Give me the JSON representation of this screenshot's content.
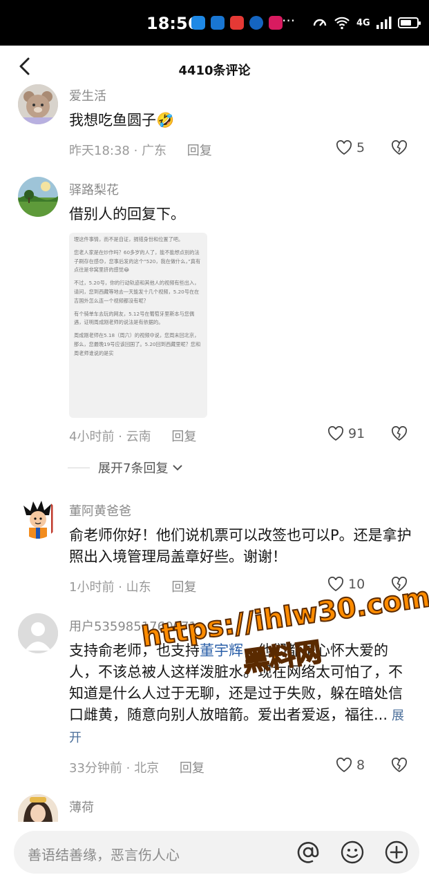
{
  "status_bar": {
    "time": "18:56",
    "network": "4G",
    "battery_level": 0.75
  },
  "header": {
    "title": "4410条评论"
  },
  "comments": [
    {
      "user": "爱生活",
      "text": "我想吃鱼圆子🤣",
      "time": "昨天18:38",
      "location": "广东",
      "reply": "回复",
      "likes": "5"
    },
    {
      "user": "驿路梨花",
      "text": "借别人的回复下。",
      "time": "4小时前",
      "location": "云南",
      "reply": "回复",
      "likes": "91",
      "expand": "展开7条回复"
    },
    {
      "user": "董阿黄爸爸",
      "text": "俞老师你好！他们说机票可以改签也可以P。还是拿护照出入境管理局盖章好些。谢谢！",
      "time": "1小时前",
      "location": "山东",
      "reply": "回复",
      "likes": "10"
    },
    {
      "user": "用户5359851760671",
      "text_prefix": "支持俞老师，也支持",
      "link": "董宇辉",
      "text_suffix": "，他们都是心怀大爱的人，不该总被人这样泼脏水。现在网络太可怕了，不知道是什么人过于无聊，还是过于失败，躲在暗处信口雌黄，随意向别人放暗箭。爱出者爱返，福往...",
      "more": "展开",
      "time": "33分钟前",
      "location": "北京",
      "reply": "回复",
      "likes": "8"
    },
    {
      "user": "薄荷"
    }
  ],
  "embedded_screenshot": [
    "理这件事情，而不是自证，捐错身份和位置了吧。",
    "您老人家是在炒作吗？60多岁的人了，能不能想点别的法子刷存在感😓，您事后发的这个“520，我在做什么，”真有点往是非窝里挤的感觉😂",
    "不过，5.20号，你的行动轨迹和其他人的视频有些出入，请问，您到西藏等地去一天能发十几个视频，5.20号在在吉国外怎么连一个视频都没有呢？",
    "有个骑单车去玩的网友，5.12号在葡萄牙里斯本与您偶遇，证明周成刚老师的说法是有依据的。",
    "周成刚老师在5.18（周六）的视频中说，您周末回北京，那么，您最晚19号应该回国了。5.20回到西藏里呢？您和周老师谁说的是实"
  ],
  "watermark": {
    "line1": "https://ihlw30.com",
    "line2": "黑料网"
  },
  "input_bar": {
    "placeholder": "善语结善缘，恶言伤人心"
  },
  "colors": {
    "link": "#2a5fa8",
    "watermark": "#ff8c00"
  }
}
